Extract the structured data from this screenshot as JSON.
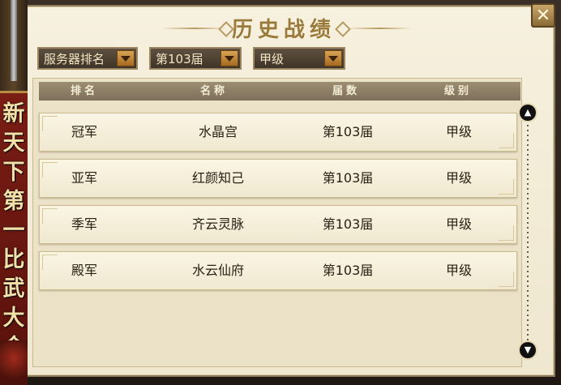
{
  "title": "历史战绩",
  "close_label": "✕",
  "banner": {
    "chars": [
      "新",
      "天",
      "下",
      "第",
      "一",
      "比",
      "武",
      "大",
      "会"
    ]
  },
  "filters": {
    "server_rank": "服务器排名",
    "session": "第103届",
    "level": "甲级"
  },
  "table": {
    "headers": [
      "排名",
      "名称",
      "届数",
      "级别"
    ],
    "rows": [
      {
        "rank": "冠军",
        "name": "水晶宫",
        "session": "第103届",
        "level": "甲级"
      },
      {
        "rank": "亚军",
        "name": "红颜知己",
        "session": "第103届",
        "level": "甲级"
      },
      {
        "rank": "季军",
        "name": "齐云灵脉",
        "session": "第103届",
        "level": "甲级"
      },
      {
        "rank": "殿军",
        "name": "水云仙府",
        "session": "第103届",
        "level": "甲级"
      }
    ]
  },
  "scroll": {
    "up_glyph": "▲",
    "down_glyph": "▼"
  },
  "colors": {
    "panel_bg": "#f6f0de",
    "header_bg": "#8e806a",
    "title": "#9a7a3c",
    "dropdown_arrow": "#d9a456",
    "banner_red": "#7a1d14"
  }
}
